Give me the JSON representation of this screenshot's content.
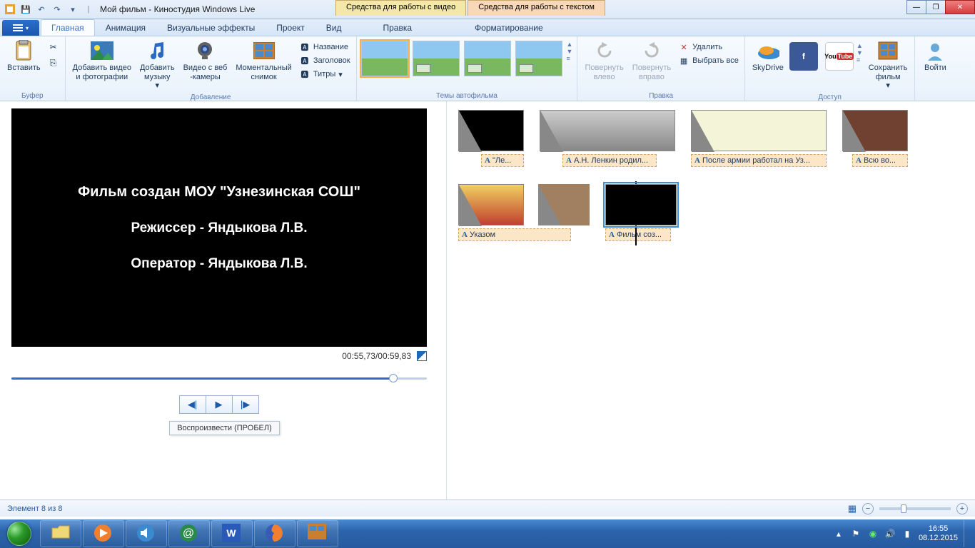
{
  "window": {
    "title": "Мой фильм - Киностудия Windows Live",
    "context_tabs": {
      "video": "Средства для работы с видео",
      "text": "Средства для работы с текстом"
    }
  },
  "tabs": {
    "home": "Главная",
    "anim": "Анимация",
    "vfx": "Визуальные эффекты",
    "project": "Проект",
    "view": "Вид",
    "edit_ctx": "Правка",
    "format_ctx": "Форматирование"
  },
  "ribbon": {
    "buffer": {
      "label": "Буфер",
      "paste": "Вставить"
    },
    "add": {
      "label": "Добавление",
      "add_video": "Добавить видео\nи фотографии",
      "add_music": "Добавить\nмузыку",
      "webcam": "Видео с веб\n-камеры",
      "snapshot": "Моментальный\nснимок",
      "name": "Название",
      "title": "Заголовок",
      "credits": "Титры"
    },
    "themes": {
      "label": "Темы автофильма"
    },
    "edit": {
      "label": "Правка",
      "rot_left": "Повернуть\nвлево",
      "rot_right": "Повернуть\nвправо",
      "delete": "Удалить",
      "select_all": "Выбрать все"
    },
    "share": {
      "label": "Доступ",
      "skydrive": "SkyDrive",
      "save": "Сохранить\nфильм"
    },
    "login": "Войти"
  },
  "preview": {
    "line1": "Фильм создан МОУ \"Узнезинская СОШ\"",
    "line2": "Режиссер - Яндыкова Л.В.",
    "line3": "Оператор - Яндыкова Л.В.",
    "time": "00:55,73/00:59,83",
    "progress_pct": 92,
    "tooltip": "Воспроизвести (ПРОБЕЛ)"
  },
  "clips": {
    "r1c1": "\"Ле...",
    "r1c2": "А.Н. Ленкин родил...",
    "r1c3": "После армии работал на Уз...",
    "r1c4": "Всю во...",
    "r2c1": "Указом",
    "r2c2": "Фильм соз..."
  },
  "statusbar": {
    "item": "Элемент 8 из 8"
  },
  "tray": {
    "time": "16:55",
    "date": "08.12.2015"
  }
}
